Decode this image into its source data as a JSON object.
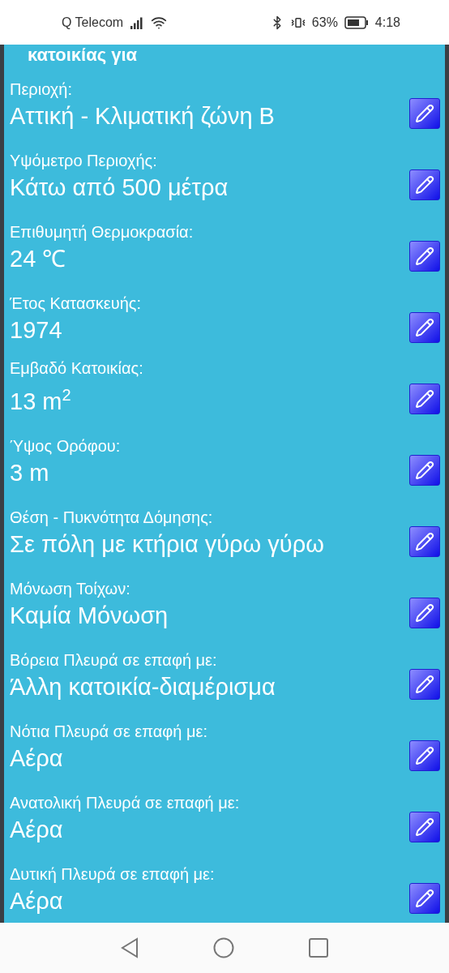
{
  "status_bar": {
    "carrier": "Q Telecom",
    "battery": "63%",
    "time": "4:18"
  },
  "header": "κατοικίας για",
  "fields": [
    {
      "label": "Περιοχή:",
      "value": "Αττική - Κλιματική ζώνη Β"
    },
    {
      "label": "Υψόμετρο Περιοχής:",
      "value": "Κάτω από 500 μέτρα"
    },
    {
      "label": "Επιθυμητή Θερμοκρασία:",
      "value": "24 ℃"
    },
    {
      "label": "Έτος Κατασκευής:",
      "value": "1974"
    },
    {
      "label": "Εμβαδό Κατοικίας:",
      "value": "13 m$^{2}$"
    },
    {
      "label": "Ύψος Ορόφου:",
      "value": "3 m"
    },
    {
      "label": "Θέση - Πυκνότητα Δόμησης:",
      "value": "Σε πόλη με κτήρια γύρω γύρω"
    },
    {
      "label": "Μόνωση Τοίχων:",
      "value": "Καμία Μόνωση"
    },
    {
      "label": "Βόρεια Πλευρά σε επαφή με:",
      "value": "Άλλη κατοικία-διαμέρισμα"
    },
    {
      "label": "Νότια Πλευρά σε επαφή με:",
      "value": "Αέρα"
    },
    {
      "label": "Ανατολική Πλευρά σε επαφή με:",
      "value": "Αέρα"
    },
    {
      "label": "Δυτική Πλευρά σε επαφή με:",
      "value": "Αέρα"
    }
  ]
}
